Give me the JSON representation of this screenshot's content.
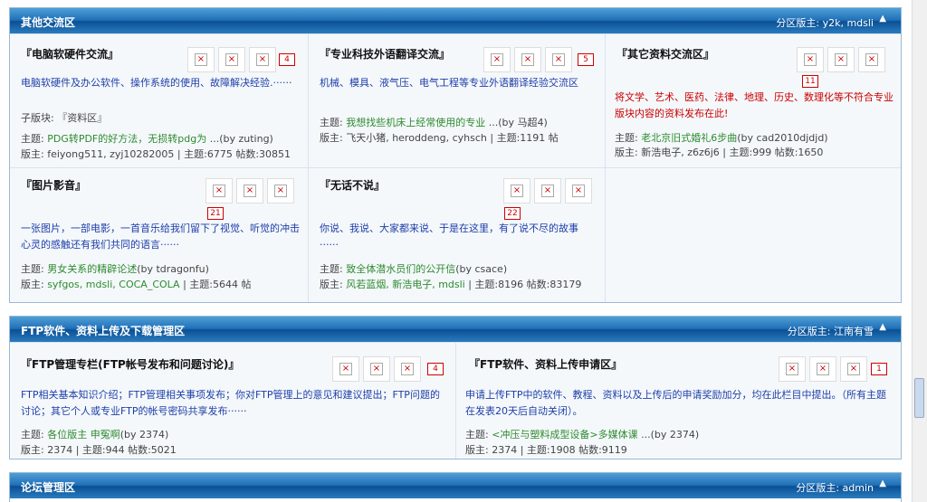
{
  "sections": [
    {
      "title": "其他交流区",
      "moderators": "分区版主: y2k, mdsli",
      "forums": [
        {
          "name": "『电脑软硬件交流』",
          "badge": "4",
          "desc": "电脑软硬件及办公软件、操作系统的使用、故障解决经验.······",
          "sub": "子版块: 『资料区』",
          "topic_label": "主题: ",
          "topic": "PDG转PDF的好方法，无损转pdg为",
          "by": " ...(by zuting)",
          "mods_prefix": "版主: ",
          "mods": "feiyong511, zyj10282005",
          "stats": " | 主题:6775 帖数:30851"
        },
        {
          "name": "『专业科技外语翻译交流』",
          "badge": "5",
          "desc": "机械、模具、液气压、电气工程等专业外语翻译经验交流区",
          "topic_label": "主题: ",
          "topic": "我想找些机床上经常使用的专业",
          "by": " ...(by 马超4)",
          "mods_prefix": "版主: ",
          "mods": "飞天小猪, heroddeng, cyhsch",
          "stats": " | 主题:1191 帖"
        },
        {
          "name": "『其它资料交流区』",
          "badge": "11",
          "desc": "将文学、艺术、医药、法律、地理、历史、数理化等不符合专业版块内容的资料发布在此!",
          "topic_label": "主题: ",
          "topic": "老北京旧式婚礼6步曲",
          "by": "(by cad2010djdjd)",
          "mods_prefix": "版主: ",
          "mods": "新浩电子, z6z6j6",
          "stats": " | 主题:999 帖数:1650"
        },
        {
          "name": "『图片影音』",
          "badge": "21",
          "desc": "一张图片，一部电影，一首音乐给我们留下了视觉、听觉的冲击心灵的感触还有我们共同的语言······",
          "topic_label": "主题: ",
          "topic": "男女关系的精辟论述",
          "by": "(by tdragonfu)",
          "mods_prefix": "版主: ",
          "mods": "syfgos, mdsli, COCA_COLA",
          "stats": " | 主题:5644 帖"
        },
        {
          "name": "『无话不说』",
          "badge": "22",
          "desc": "你说、我说、大家都来说、于是在这里，有了说不尽的故事······",
          "topic_label": "主题: ",
          "topic": "致全体潜水员们的公开信",
          "by": "(by csace)",
          "mods_prefix": "版主: ",
          "mods": "风若蓝烟, 新浩电子, mdsli",
          "stats": " | 主题:8196 帖数:83179"
        }
      ]
    },
    {
      "title": "FTP软件、资料上传及下载管理区",
      "moderators": "分区版主: 江南有雪",
      "forums": [
        {
          "name": "『FTP管理专栏(FTP帐号发布和问题讨论)』",
          "badge": "4",
          "desc": "FTP相关基本知识介绍；FTP管理相关事项发布；你对FTP管理上的意见和建议提出；FTP问题的讨论；其它个人或专业FTP的帐号密码共享发布······",
          "topic_label": "主题: ",
          "topic": "各位版主 申冤啊",
          "by": "(by 2374)",
          "mods_prefix": "版主: ",
          "mods": "2374",
          "stats": " | 主题:944 帖数:5021"
        },
        {
          "name": "『FTP软件、资料上传申请区』",
          "badge": "1",
          "desc": "申请上传FTP中的软件、教程、资料以及上传后的申请奖励加分，均在此栏目中提出。（所有主题在发表20天后自动关闭）。",
          "topic_label": "主题: ",
          "topic": "<冲压与塑料成型设备>多媒体课",
          "by": " ...(by 2374)",
          "mods_prefix": "版主: ",
          "mods": "2374",
          "stats": " | 主题:1908 帖数:9119"
        }
      ]
    },
    {
      "title": "论坛管理区",
      "moderators": "分区版主: admin"
    }
  ],
  "icons": {
    "broken": "×",
    "collapse": "▲"
  }
}
